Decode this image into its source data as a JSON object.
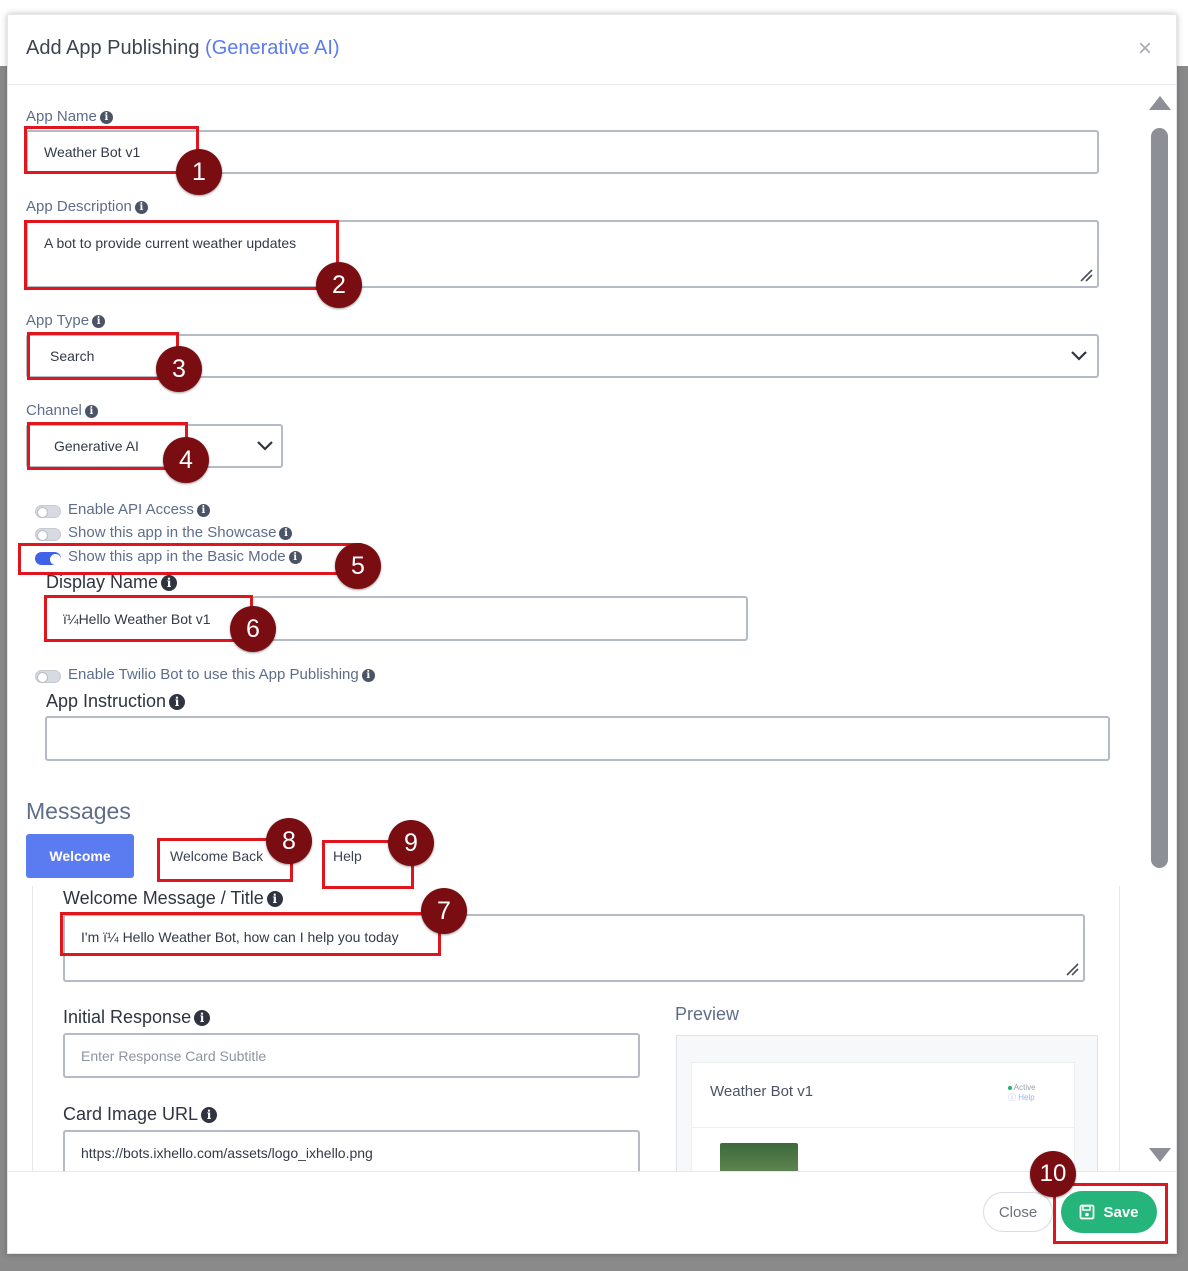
{
  "modal": {
    "title_main": "Add App Publishing",
    "title_accent": "(Generative AI)",
    "close_icon": "×"
  },
  "form": {
    "app_name": {
      "label": "App Name",
      "value": "Weather Bot v1"
    },
    "app_description": {
      "label": "App Description",
      "value": "A bot to provide current weather updates"
    },
    "app_type": {
      "label": "App Type",
      "value": "Search"
    },
    "channel": {
      "label": "Channel",
      "value": "Generative AI"
    },
    "toggles": [
      {
        "label": "Enable API Access",
        "on": false
      },
      {
        "label": "Show this app in the Showcase",
        "on": false
      },
      {
        "label": "Show this app in the Basic Mode",
        "on": true
      }
    ],
    "display_name": {
      "label": "Display Name",
      "value": "ï¼Hello Weather Bot v1"
    },
    "twilio_toggle": {
      "label": "Enable Twilio Bot to use this App Publishing",
      "on": false
    },
    "app_instruction": {
      "label": "App Instruction",
      "value": ""
    }
  },
  "messages": {
    "heading": "Messages",
    "tabs": [
      "Welcome",
      "Welcome Back",
      "Help"
    ],
    "active_tab": "Welcome",
    "welcome_message": {
      "label": "Welcome Message / Title",
      "value": "I'm ï¼ Hello Weather Bot, how can I help you today"
    },
    "initial_response": {
      "label": "Initial Response",
      "placeholder": "Enter Response Card Subtitle"
    },
    "card_image_url": {
      "label": "Card Image URL",
      "value": "https://bots.ixhello.com/assets/logo_ixhello.png"
    },
    "preview": {
      "heading": "Preview",
      "bot_name": "Weather Bot v1",
      "status_active": "Active",
      "status_help": "Help"
    }
  },
  "footer": {
    "close_label": "Close",
    "save_label": "Save"
  },
  "annotations": [
    "1",
    "2",
    "3",
    "4",
    "5",
    "6",
    "7",
    "8",
    "9",
    "10"
  ],
  "colors": {
    "accent": "#5b7bf0",
    "save_green": "#25b57a",
    "highlight_red": "#e0161e",
    "badge_maroon": "#7a0d12"
  }
}
